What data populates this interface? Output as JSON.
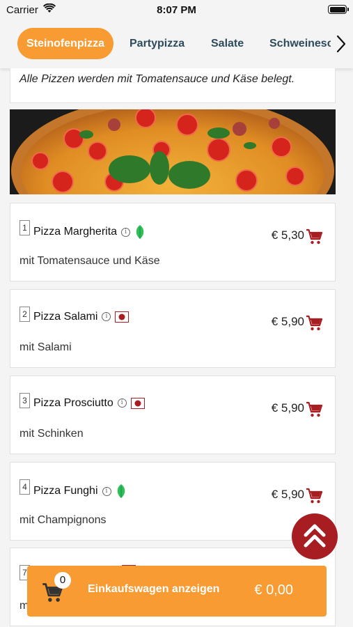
{
  "status_bar": {
    "carrier": "Carrier",
    "time": "8:07 PM"
  },
  "tabs": [
    "Steinofenpizza",
    "Partypizza",
    "Salate",
    "Schweinesc"
  ],
  "active_tab": "Steinofenpizza",
  "note": "Alle Pizzen werden mit Tomatensauce und Käse belegt.",
  "items": [
    {
      "number": "1",
      "name": "Pizza Margherita",
      "tag": "vegetarian-leaf-icon",
      "description": "mit Tomatensauce und Käse",
      "price": "€ 5,30"
    },
    {
      "number": "2",
      "name": "Pizza Salami",
      "tag": "pork-badge-icon",
      "description": "mit Salami",
      "price": "€ 5,90"
    },
    {
      "number": "3",
      "name": "Pizza Prosciutto",
      "tag": "pork-badge-icon",
      "description": "mit Schinken",
      "price": "€ 5,90"
    },
    {
      "number": "4",
      "name": "Pizza Funghi",
      "tag": "vegetarian-leaf-icon",
      "description": "mit Champignons",
      "price": "€ 5,90"
    },
    {
      "number": "7",
      "name": "",
      "tag": "pork-badge-icon",
      "description": "m",
      "price": ""
    }
  ],
  "cart": {
    "count": "0",
    "label": "Einkaufswagen anzeigen",
    "total": "€ 0,00"
  },
  "colors": {
    "accent": "#f79b32",
    "cart_icon": "#a81d22",
    "tab_text": "#2d4b5a",
    "leaf": "#2fbf5a"
  },
  "icons": {
    "info": "i"
  }
}
